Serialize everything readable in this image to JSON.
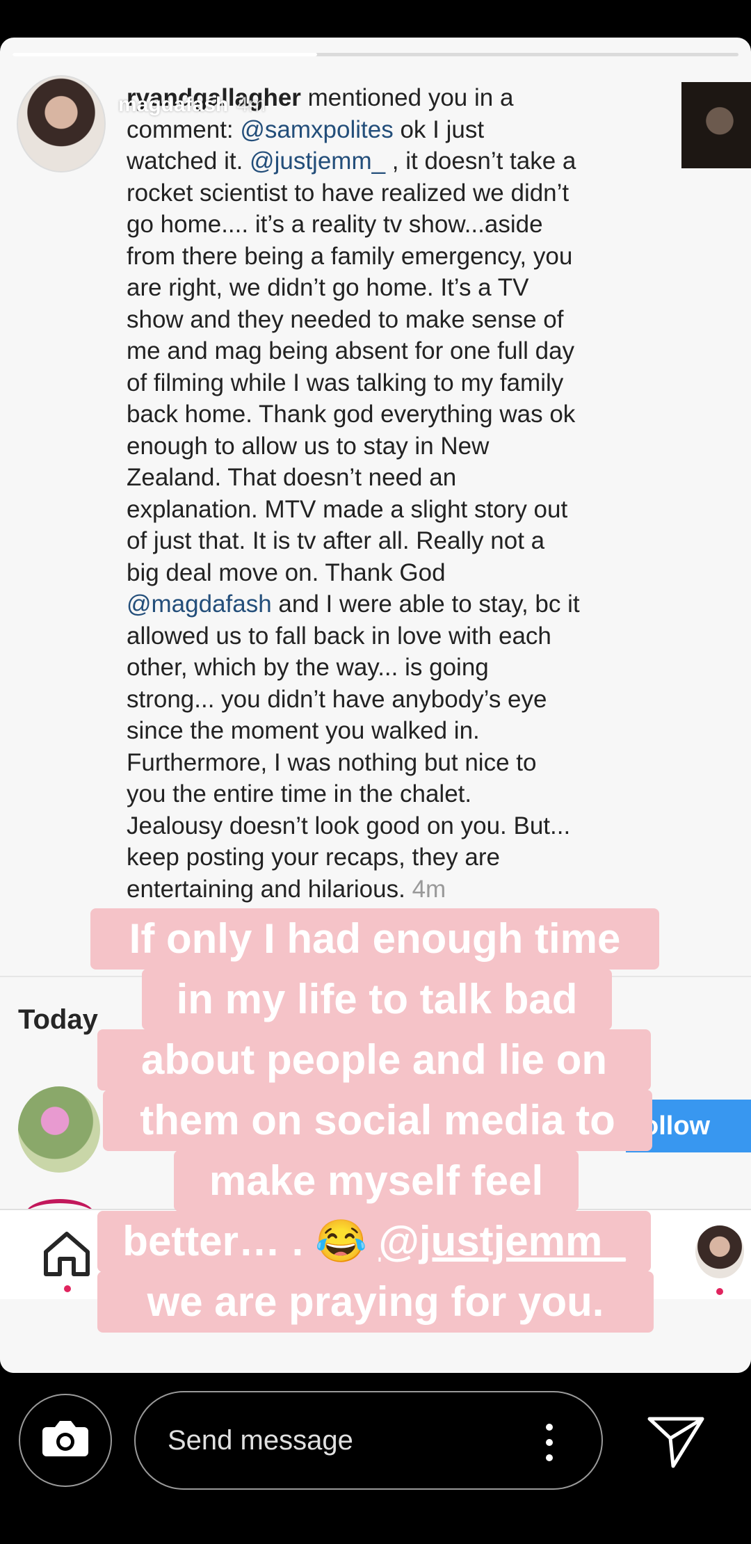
{
  "story": {
    "username": "magdafash",
    "time": "4m",
    "progress": 0.42
  },
  "comment": {
    "username": "ryandgallagher",
    "lines": [
      [
        {
          "t": "",
          "c": "uname",
          "k": "user"
        },
        {
          "t": " mentioned you in a",
          "c": ""
        }
      ],
      [
        {
          "t": "comment: ",
          "c": ""
        },
        {
          "t": "@samxpolites",
          "c": "mention"
        },
        {
          "t": " ok I just",
          "c": ""
        }
      ],
      [
        {
          "t": "watched it. ",
          "c": ""
        },
        {
          "t": "@justjemm_",
          "c": "mention"
        },
        {
          "t": " , it doesn’t take a",
          "c": ""
        }
      ],
      [
        {
          "t": "rocket scientist to have realized we didn’t",
          "c": ""
        }
      ],
      [
        {
          "t": "go home.... it’s a reality tv show...aside",
          "c": ""
        }
      ],
      [
        {
          "t": "from there being a family emergency, you",
          "c": ""
        }
      ],
      [
        {
          "t": "are right, we didn’t go home. It’s a TV",
          "c": ""
        }
      ],
      [
        {
          "t": "show and they needed to make sense of",
          "c": ""
        }
      ],
      [
        {
          "t": "me and mag being absent for one full day",
          "c": ""
        }
      ],
      [
        {
          "t": "of filming while I was talking to my family",
          "c": ""
        }
      ],
      [
        {
          "t": "back home. Thank god everything was ok",
          "c": ""
        }
      ],
      [
        {
          "t": "enough to allow us to stay in New",
          "c": ""
        }
      ],
      [
        {
          "t": "Zealand. That doesn’t need an",
          "c": ""
        }
      ],
      [
        {
          "t": "explanation. MTV made a slight story out",
          "c": ""
        }
      ],
      [
        {
          "t": "of just that. It is tv after all. Really not a",
          "c": ""
        }
      ],
      [
        {
          "t": "big deal move on.  Thank God",
          "c": ""
        }
      ],
      [
        {
          "t": "@magdafash",
          "c": "mention"
        },
        {
          "t": " and I were able to stay, bc it",
          "c": ""
        }
      ],
      [
        {
          "t": "allowed us to fall back in love with each",
          "c": ""
        }
      ],
      [
        {
          "t": "other, which by the way... is going",
          "c": ""
        }
      ],
      [
        {
          "t": "strong... you didn’t have anybody’s eye",
          "c": ""
        }
      ],
      [
        {
          "t": "since the moment you walked in.",
          "c": ""
        }
      ],
      [
        {
          "t": "Furthermore, I was nothing but nice to",
          "c": ""
        }
      ],
      [
        {
          "t": "you the entire time in the chalet.",
          "c": ""
        }
      ],
      [
        {
          "t": "Jealousy doesn’t look good on you. But...",
          "c": ""
        }
      ],
      [
        {
          "t": "keep posting your recaps, they are",
          "c": ""
        }
      ],
      [
        {
          "t": "entertaining and hilarious. ",
          "c": ""
        },
        {
          "t": "4m",
          "c": "ts"
        }
      ]
    ]
  },
  "notifications": {
    "section_label": "Today",
    "follow_label": "ollow"
  },
  "caption": {
    "lines": [
      "If only I had enough time",
      "in my life to talk bad",
      "about people and lie on",
      "them on social media to",
      "make myself feel",
      "better… . 😂 @justjemm_",
      "we are praying for you."
    ],
    "underlined_mention": "@justjemm_",
    "highlight_color": "#f5c3c8"
  },
  "message_bar": {
    "placeholder": "Send message",
    "icons": [
      "camera-icon",
      "more-vertical-icon",
      "send-icon"
    ]
  },
  "colors": {
    "mention": "#234e7a",
    "follow_button": "#3897f0",
    "notification_dot": "#e0245e"
  }
}
